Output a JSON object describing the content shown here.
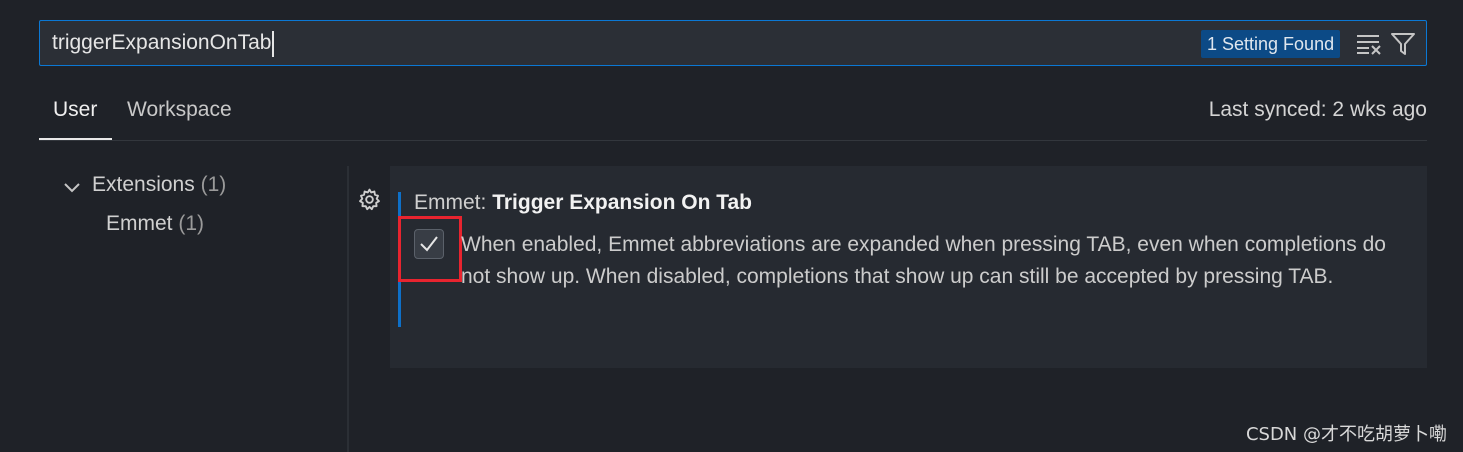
{
  "search": {
    "value": "triggerExpansionOnTab",
    "result_count": "1 Setting Found",
    "clear_icon": "clear-filter-icon",
    "filter_icon": "filter-icon"
  },
  "tabs": [
    {
      "label": "User",
      "active": true
    },
    {
      "label": "Workspace",
      "active": false
    }
  ],
  "sync_status": "Last synced: 2 wks ago",
  "tree": {
    "group": {
      "label": "Extensions",
      "count": "(1)",
      "expanded": true
    },
    "items": [
      {
        "label": "Emmet",
        "count": "(1)"
      }
    ]
  },
  "setting": {
    "category": "Emmet: ",
    "name": "Trigger Expansion On Tab",
    "checked": true,
    "description": "When enabled, Emmet abbreviations are expanded when pressing TAB, even when completions do not show up. When disabled, completions that show up can still be accepted by pressing TAB.",
    "gear_icon": "gear-icon"
  },
  "watermark": "CSDN @才不吃胡萝卜嘞",
  "colors": {
    "accent": "#0b78d4",
    "modified_indicator": "#0e70c8",
    "highlight": "#e8242f",
    "background": "#1f2228"
  }
}
